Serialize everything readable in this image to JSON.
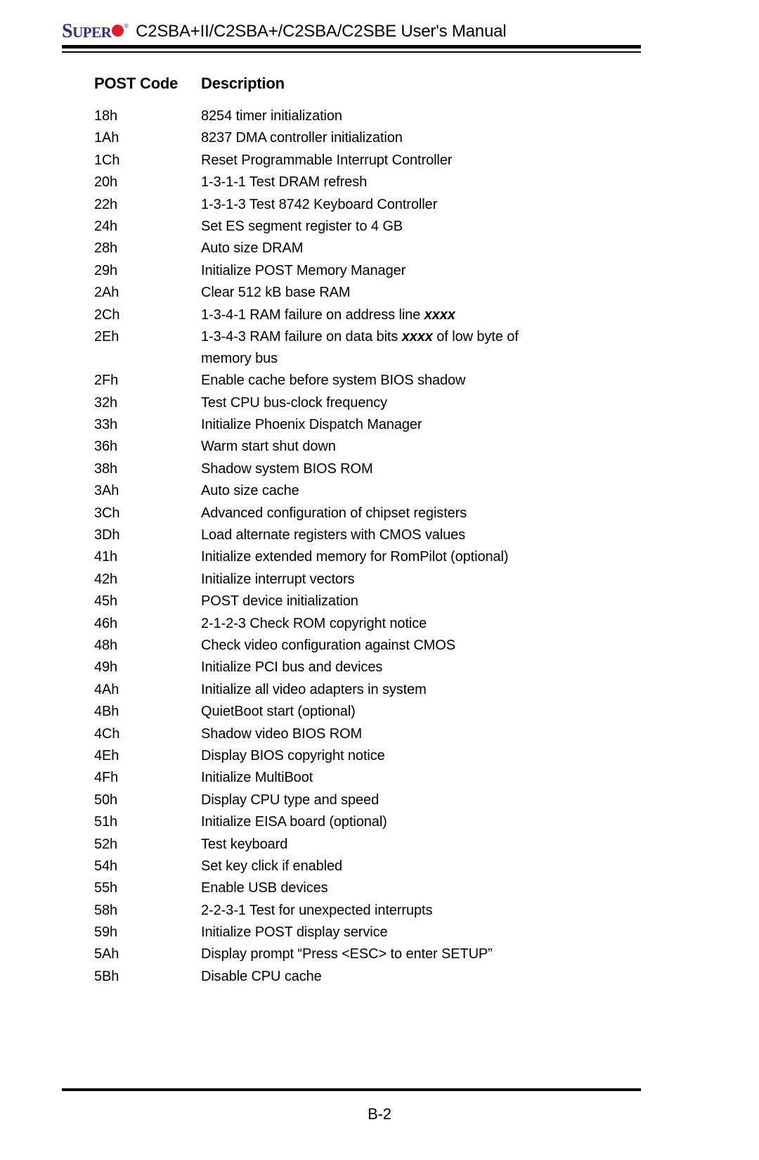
{
  "header": {
    "logo_super": "SUPER",
    "logo_trademark": "®",
    "title": "C2SBA+II/C2SBA+/C2SBA/C2SBE User's Manual",
    "logo_color": "#2b2f8f",
    "logo_dot_color": "#e8192c"
  },
  "table": {
    "col_code_header": "POST Code",
    "col_desc_header": "Description",
    "rows": [
      {
        "code": "18h",
        "desc": "8254 timer initialization"
      },
      {
        "code": "1Ah",
        "desc": "8237 DMA controller initialization"
      },
      {
        "code": "1Ch",
        "desc": "Reset Programmable Interrupt Controller"
      },
      {
        "code": "20h",
        "desc": "1-3-1-1 Test DRAM refresh"
      },
      {
        "code": "22h",
        "desc": "1-3-1-3 Test 8742 Keyboard Controller"
      },
      {
        "code": "24h",
        "desc": "Set ES segment register to 4 GB"
      },
      {
        "code": "28h",
        "desc": "Auto size DRAM"
      },
      {
        "code": "29h",
        "desc": "Initialize POST Memory Manager"
      },
      {
        "code": "2Ah",
        "desc": "Clear 512 kB base RAM"
      },
      {
        "code": "2Ch",
        "desc": "1-3-4-1 RAM failure on address line ",
        "var": "xxxx",
        "desc_after": ""
      },
      {
        "code": "2Eh",
        "desc": "1-3-4-3 RAM failure on data bits ",
        "var": "xxxx",
        "desc_after": " of low byte of",
        "cont": "memory bus"
      },
      {
        "code": "2Fh",
        "desc": "Enable cache before system BIOS shadow"
      },
      {
        "code": "32h",
        "desc": "Test CPU bus-clock frequency"
      },
      {
        "code": "33h",
        "desc": "Initialize Phoenix Dispatch Manager"
      },
      {
        "code": "36h",
        "desc": "Warm start shut down"
      },
      {
        "code": "38h",
        "desc": "Shadow system BIOS ROM"
      },
      {
        "code": "3Ah",
        "desc": "Auto size cache"
      },
      {
        "code": "3Ch",
        "desc": "Advanced configuration of chipset registers"
      },
      {
        "code": "3Dh",
        "desc": "Load alternate registers with CMOS values"
      },
      {
        "code": "41h",
        "desc": "Initialize extended memory for RomPilot (optional)"
      },
      {
        "code": "42h",
        "desc": "Initialize interrupt vectors"
      },
      {
        "code": "45h",
        "desc": "POST device initialization"
      },
      {
        "code": "46h",
        "desc": "2-1-2-3 Check ROM copyright notice"
      },
      {
        "code": "48h",
        "desc": "Check video configuration against CMOS"
      },
      {
        "code": "49h",
        "desc": "Initialize PCI bus and devices"
      },
      {
        "code": "4Ah",
        "desc": "Initialize all video adapters in system"
      },
      {
        "code": "4Bh",
        "desc": "QuietBoot start (optional)"
      },
      {
        "code": "4Ch",
        "desc": "Shadow video BIOS ROM"
      },
      {
        "code": "4Eh",
        "desc": "Display BIOS copyright notice"
      },
      {
        "code": "4Fh",
        "desc": "Initialize MultiBoot"
      },
      {
        "code": "50h",
        "desc": "Display CPU type and speed"
      },
      {
        "code": "51h",
        "desc": "Initialize EISA board (optional)"
      },
      {
        "code": "52h",
        "desc": "Test keyboard"
      },
      {
        "code": "54h",
        "desc": "Set key click if enabled"
      },
      {
        "code": "55h",
        "desc": "Enable USB devices"
      },
      {
        "code": "58h",
        "desc": "2-2-3-1 Test for unexpected interrupts"
      },
      {
        "code": "59h",
        "desc": "Initialize POST display service"
      },
      {
        "code": "5Ah",
        "desc": "Display prompt “Press <ESC> to enter SETUP”"
      },
      {
        "code": "5Bh",
        "desc": "Disable CPU cache"
      }
    ]
  },
  "footer": {
    "page_number": "B-2"
  }
}
